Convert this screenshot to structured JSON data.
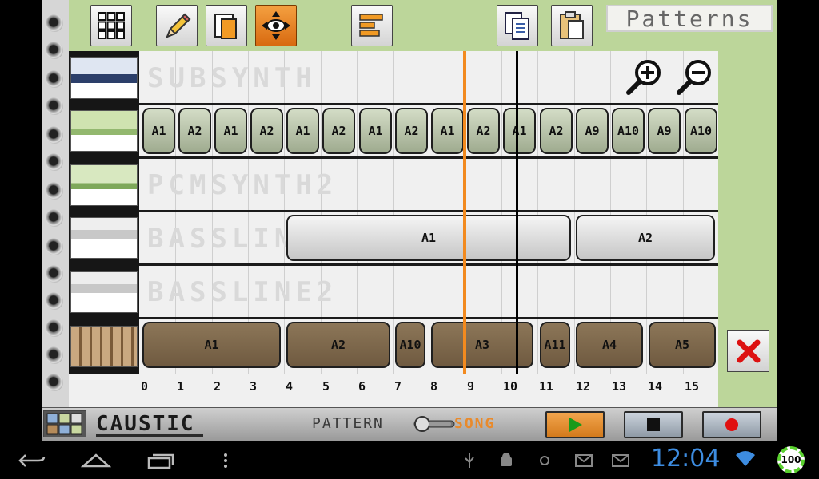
{
  "toolbar": {
    "mode_label": "Patterns"
  },
  "tracks": [
    {
      "name": "SUBSYNTH"
    },
    {
      "name": ""
    },
    {
      "name": "PCMSYNTH2"
    },
    {
      "name": "BASSLIN"
    },
    {
      "name": "BASSLINE2"
    },
    {
      "name": ""
    }
  ],
  "patterns": [
    {
      "row": 1,
      "label": "A1"
    },
    {
      "row": 1,
      "label": "A2"
    },
    {
      "row": 1,
      "label": "A1"
    },
    {
      "row": 1,
      "label": "A2"
    },
    {
      "row": 1,
      "label": "A1"
    },
    {
      "row": 1,
      "label": "A2"
    },
    {
      "row": 1,
      "label": "A1"
    },
    {
      "row": 1,
      "label": "A2"
    },
    {
      "row": 1,
      "label": "A1"
    },
    {
      "row": 1,
      "label": "A2"
    },
    {
      "row": 1,
      "label": "A1"
    },
    {
      "row": 1,
      "label": "A2"
    },
    {
      "row": 1,
      "label": "A9"
    },
    {
      "row": 1,
      "label": "A10"
    },
    {
      "row": 1,
      "label": "A9"
    },
    {
      "row": 1,
      "label": "A10"
    },
    {
      "row": 3,
      "label": "A1"
    },
    {
      "row": 3,
      "label": "A2"
    },
    {
      "row": 5,
      "label": "A1"
    },
    {
      "row": 5,
      "label": "A2"
    },
    {
      "row": 5,
      "label": "A10"
    },
    {
      "row": 5,
      "label": "A3"
    },
    {
      "row": 5,
      "label": "A11"
    },
    {
      "row": 5,
      "label": "A4"
    },
    {
      "row": 5,
      "label": "A5"
    }
  ],
  "ruler": {
    "ticks": [
      "0",
      "1",
      "2",
      "3",
      "4",
      "5",
      "6",
      "7",
      "8",
      "9",
      "10",
      "11",
      "12",
      "13",
      "14",
      "15"
    ]
  },
  "bottom_bar": {
    "brand": "CAUSTIC",
    "pattern_label": "PATTERN",
    "song_label": "SONG"
  },
  "status_bar": {
    "time": "12:04",
    "battery": "100"
  },
  "colors": {
    "panel": "#bcd69a",
    "playhead": "#f28a1f",
    "accent": "#e98a2b"
  }
}
